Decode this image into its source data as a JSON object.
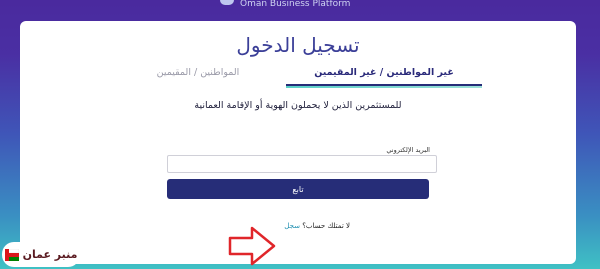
{
  "header": {
    "logo_text": "Oman Business Platform"
  },
  "login": {
    "title": "تسجيل الدخول",
    "tabs": [
      {
        "label": "غير المواطنين / غير المقيمين",
        "active": true
      },
      {
        "label": "المواطنين / المقيمين",
        "active": false
      }
    ],
    "subtitle": "للمستثمرين الذين لا يحملون الهوية أو الإقامة العمانية",
    "email_label": "البريد الإلكتروني",
    "email_value": "",
    "continue_label": "تابع",
    "no_account_text": "لا تمتلك حساب؟",
    "signup_link": "سجل"
  },
  "watermark": {
    "text": "منبر عمان"
  },
  "colors": {
    "primary": "#262d78",
    "title": "#3b3f98",
    "link": "#1f8fb0",
    "annotation_arrow": "#e0262a",
    "bg_top": "#4a2a9e",
    "bg_bottom": "#3fc1c4"
  },
  "icons": [
    "logo-mark-icon",
    "red-arrow-annotation-icon",
    "oman-flag-icon"
  ]
}
